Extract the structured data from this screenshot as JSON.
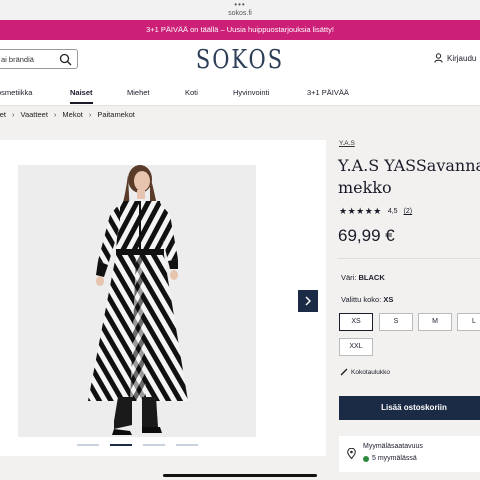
{
  "browser": {
    "dots": "•••",
    "url": "sokos.fi"
  },
  "promo": {
    "text": "3+1 PÄIVÄÄ on täällä – Uusia huippuostarjouksia lisätty!"
  },
  "header": {
    "search_placeholder": "ai brändiä",
    "logo": "SOKOS",
    "login_label": "Kirjaudu",
    "nav": [
      "osmetiikka",
      "Naiset",
      "Miehet",
      "Koti",
      "Hyvinvointi",
      "3+1 PÄIVÄÄ"
    ],
    "active_nav": "Naiset"
  },
  "breadcrumb": [
    "set",
    "Vaatteet",
    "Mekot",
    "Paitamekot"
  ],
  "gallery": {
    "image_alt": "Y.A.S YASSavanna mekko",
    "dots_count": 4,
    "active_dot": 1
  },
  "product": {
    "brand": "Y.A.S",
    "title_line1": "Y.A.S YASSavanna",
    "title_line2": "mekko",
    "stars": "★★★★★",
    "rating": "4,5",
    "review_count": "(2)",
    "price": "69,99 €",
    "color_label": "Väri:",
    "color_value": "BLACK",
    "size_label": "Valittu koko:",
    "size_value": "XS",
    "sizes": [
      "XS",
      "S",
      "M",
      "L",
      "XXL"
    ],
    "selected_size": "XS",
    "size_guide": "Kokotaulukko",
    "add_to_cart": "Lisää ostoskoriin",
    "availability_title": "Myymäläsaatavuus",
    "availability_stores": "5 myymälässä"
  },
  "colors": {
    "navy": "#1c2b45",
    "promo": "#cc1f77",
    "in_stock": "#2e8b3e"
  }
}
